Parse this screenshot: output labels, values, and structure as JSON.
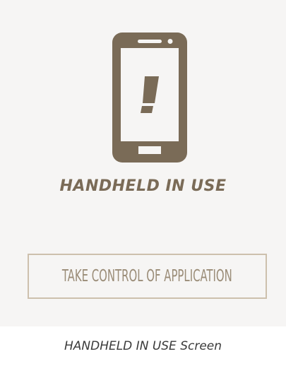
{
  "screen": {
    "icon": "mobile-phone-alert-icon",
    "title": "HANDHELD IN USE",
    "button_label": "TAKE CONTROL OF APPLICATION"
  },
  "caption": "HANDHELD IN USE Screen",
  "colors": {
    "panel_background": "#f6f5f4",
    "brand_brown": "#7a6b57",
    "button_border": "#cdc0ad",
    "button_text": "#9a8c77"
  }
}
